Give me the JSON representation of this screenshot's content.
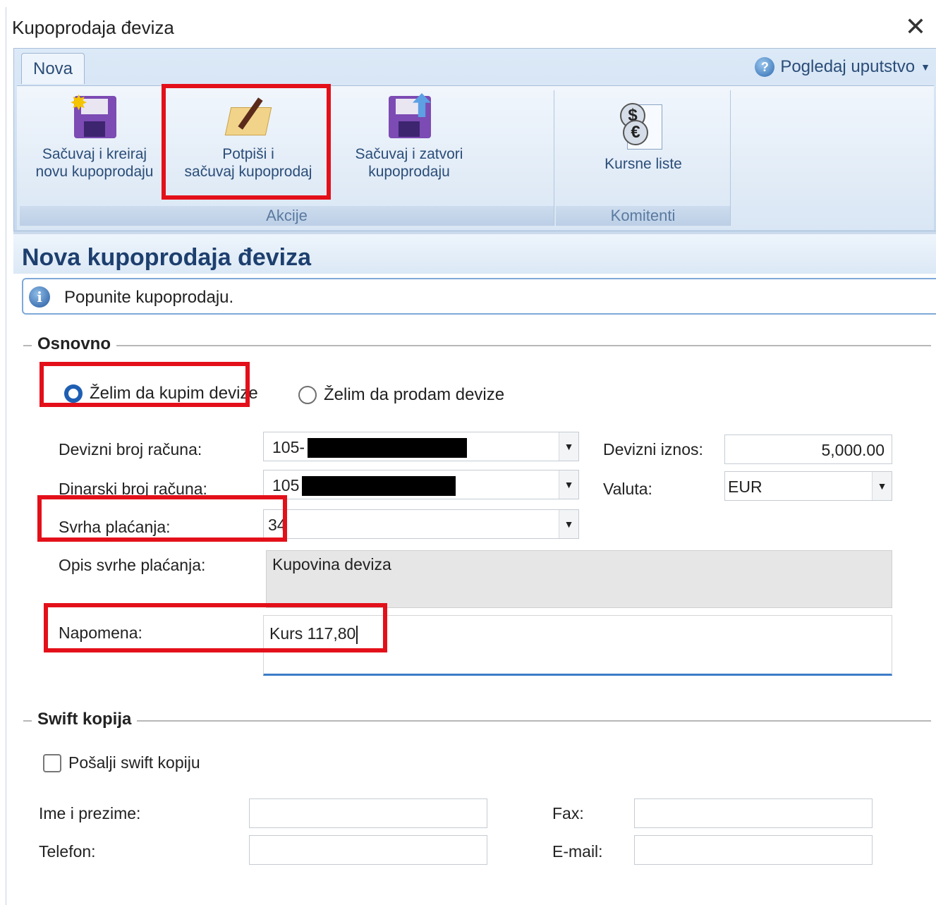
{
  "window": {
    "title": "Kupoprodaja đeviza",
    "close_glyph": "✕"
  },
  "ribbon": {
    "tab": "Nova",
    "help": {
      "label": "Pogledaj uputstvo",
      "icon": "help-icon"
    },
    "groups": {
      "akcije": {
        "label": "Akcije",
        "save_new_line1": "Sačuvaj i kreiraj",
        "save_new_line2": "novu kupoprodaju",
        "sign_save_line1": "Potpiši i",
        "sign_save_line2": "sačuvaj kupoprodaj",
        "save_close_line1": "Sačuvaj i zatvori",
        "save_close_line2": "kupoprodaju"
      },
      "komitenti": {
        "label": "Komitenti",
        "rates": "Kursne liste"
      }
    }
  },
  "page": {
    "title": "Nova kupoprodaja đeviza",
    "info": "Popunite kupoprodaju."
  },
  "osnovno": {
    "label": "Osnovno",
    "radio_buy": "Želim da kupim devize",
    "radio_sell": "Želim da prodam devize",
    "selected": "buy",
    "fx_account_label": "Devizni broj računa:",
    "fx_account_value": "105-",
    "din_account_label": "Dinarski broj računa:",
    "din_account_value": "105",
    "purpose_label": "Svrha plaćanja:",
    "purpose_value": "34",
    "purpose_desc_label": "Opis svrhe plaćanja:",
    "purpose_desc_value": "Kupovina deviza",
    "note_label": "Napomena:",
    "note_value": "Kurs 117,80",
    "amount_label": "Devizni iznos:",
    "amount_value": "5,000.00",
    "currency_label": "Valuta:",
    "currency_value": "EUR"
  },
  "swift": {
    "label": "Swift kopija",
    "checkbox": "Pošalji swift kopiju",
    "checked": false,
    "name_label": "Ime i prezime:",
    "phone_label": "Telefon:",
    "fax_label": "Fax:",
    "email_label": "E-mail:"
  },
  "colors": {
    "highlight": "#e3101a",
    "accent": "#1f5fb3",
    "title": "#1d3f6e"
  }
}
